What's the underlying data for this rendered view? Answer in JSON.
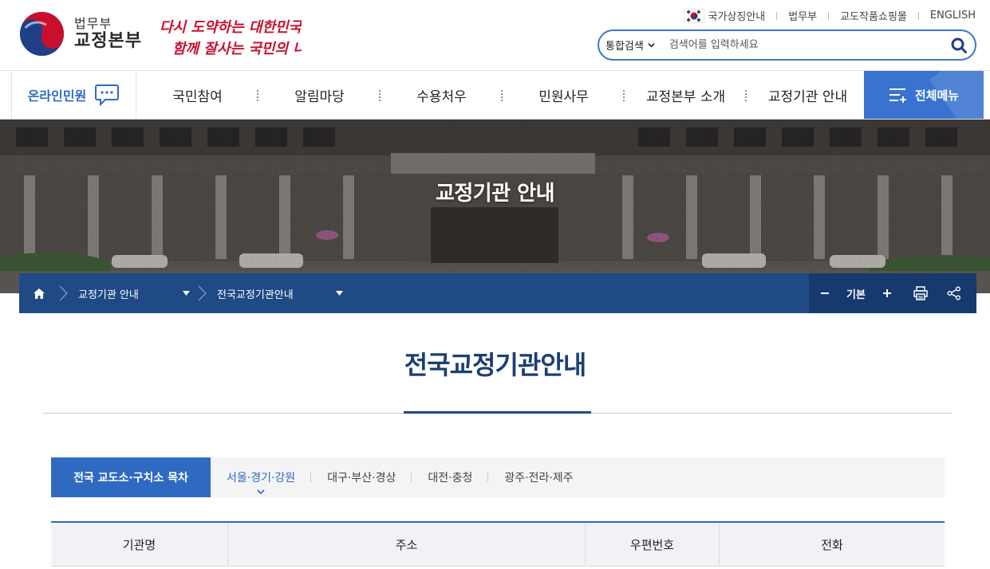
{
  "header": {
    "logo_small": "법무부",
    "logo_big": "교정본부",
    "slogan_line1": "다시 도약하는 대한민국",
    "slogan_line2": "함께 잘사는 국민의 나라",
    "util_links": [
      "국가상징안내",
      "법무부",
      "교도작품쇼핑몰",
      "ENGLISH"
    ],
    "search": {
      "type_label": "통합검색",
      "placeholder": "검색어를 입력하세요"
    }
  },
  "gnb": {
    "online_label": "온라인민원",
    "menu": [
      "국민참여",
      "알림마당",
      "수용처우",
      "민원사무",
      "교정본부 소개",
      "교정기관 안내"
    ],
    "all_menu_label": "전체메뉴"
  },
  "visual": {
    "title": "교정기관 안내"
  },
  "location": {
    "crumbs": [
      "교정기관 안내",
      "전국교정기관안내"
    ],
    "zoom_label": "기본"
  },
  "content": {
    "page_title": "전국교정기관안내",
    "tabs": {
      "main": "전국 교도소·구치소 목차",
      "items": [
        "서울·경기·강원",
        "대구·부산·경상",
        "대전·충청",
        "광주·전라·제주"
      ],
      "active_index": 0
    },
    "table_headers": [
      "기관명",
      "주소",
      "우편번호",
      "전화"
    ]
  },
  "colors": {
    "brand_blue": "#2e6ac2",
    "navy": "#1f4a86",
    "title_navy": "#1b3f73"
  }
}
